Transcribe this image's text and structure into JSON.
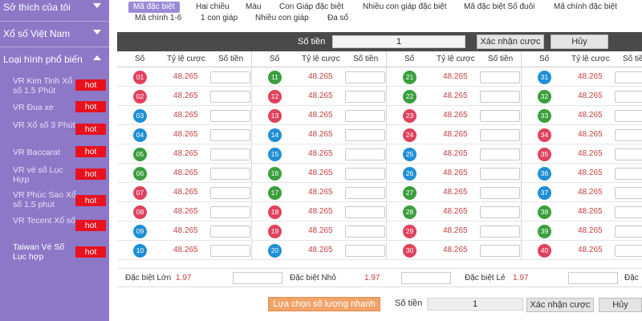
{
  "sidebar": {
    "sections": [
      {
        "label": "Sở thích của tôi",
        "open": false
      },
      {
        "label": "Xổ số Việt Nam",
        "open": false
      },
      {
        "label": "Loại hình phổ biến",
        "open": true
      }
    ],
    "items": [
      {
        "label": "VR Kim Tinh Xổ số 1.5 Phút",
        "badge": "hot"
      },
      {
        "label": "VR Đua xe",
        "badge": "hot"
      },
      {
        "label": "VR Xổ số 3 Phút",
        "badge": "hot"
      },
      {
        "label": "VR Baccarat",
        "badge": "hot"
      },
      {
        "label": "VR vé số Lục Hợp",
        "badge": "hot"
      },
      {
        "label": "VR Phúc Sao Xổ số 1.5 phút",
        "badge": "hot"
      },
      {
        "label": "VR Tecent Xổ số",
        "badge": "hot"
      },
      {
        "label": "Taiwan Vé Số Lục hợp",
        "badge": "hot"
      }
    ]
  },
  "tabs": [
    {
      "label": "Mã đặc biệt",
      "active": true
    },
    {
      "label": "Hai chiều"
    },
    {
      "label": "Màu"
    },
    {
      "label": "Con Giáp đặc biệt"
    },
    {
      "label": "Nhiều con giáp đặc biệt"
    },
    {
      "label": "Mã đặc biệt Số đuôi"
    },
    {
      "label": "Mã chính đặc biệt"
    },
    {
      "label": "Mã chính 1-6"
    },
    {
      "label": "1 con giáp"
    },
    {
      "label": "Nhiều con giáp"
    },
    {
      "label": "Đa số"
    }
  ],
  "topbar": {
    "amount_label": "Số tiền",
    "amount_value": "1",
    "confirm": "Xác nhận cược",
    "cancel": "Hủy"
  },
  "grid": {
    "headers": {
      "number": "Số",
      "odds": "Tỷ lệ cược",
      "amount": "Số tiền"
    },
    "odds": "48.265",
    "colors": {
      "red": "#e0425e",
      "green": "#3a9f3c",
      "blue": "#1f8fd6"
    },
    "numbers": [
      {
        "n": "01",
        "c": "red"
      },
      {
        "n": "02",
        "c": "red"
      },
      {
        "n": "03",
        "c": "blue"
      },
      {
        "n": "04",
        "c": "blue"
      },
      {
        "n": "05",
        "c": "green"
      },
      {
        "n": "06",
        "c": "green"
      },
      {
        "n": "07",
        "c": "red"
      },
      {
        "n": "08",
        "c": "red"
      },
      {
        "n": "09",
        "c": "blue"
      },
      {
        "n": "10",
        "c": "blue"
      },
      {
        "n": "11",
        "c": "green"
      },
      {
        "n": "12",
        "c": "red"
      },
      {
        "n": "13",
        "c": "red"
      },
      {
        "n": "14",
        "c": "blue"
      },
      {
        "n": "15",
        "c": "blue"
      },
      {
        "n": "16",
        "c": "green"
      },
      {
        "n": "17",
        "c": "green"
      },
      {
        "n": "18",
        "c": "red"
      },
      {
        "n": "19",
        "c": "red"
      },
      {
        "n": "20",
        "c": "blue"
      },
      {
        "n": "21",
        "c": "green"
      },
      {
        "n": "22",
        "c": "green"
      },
      {
        "n": "23",
        "c": "red"
      },
      {
        "n": "24",
        "c": "red"
      },
      {
        "n": "25",
        "c": "blue"
      },
      {
        "n": "26",
        "c": "blue"
      },
      {
        "n": "27",
        "c": "green"
      },
      {
        "n": "28",
        "c": "green"
      },
      {
        "n": "29",
        "c": "red"
      },
      {
        "n": "30",
        "c": "red"
      },
      {
        "n": "31",
        "c": "blue"
      },
      {
        "n": "32",
        "c": "green"
      },
      {
        "n": "33",
        "c": "green"
      },
      {
        "n": "34",
        "c": "red"
      },
      {
        "n": "35",
        "c": "red"
      },
      {
        "n": "36",
        "c": "blue"
      },
      {
        "n": "37",
        "c": "blue"
      },
      {
        "n": "38",
        "c": "green"
      },
      {
        "n": "39",
        "c": "green"
      },
      {
        "n": "40",
        "c": "red"
      }
    ]
  },
  "special": [
    {
      "label": "Đặc biệt Lớn",
      "odds": "1.97"
    },
    {
      "label": "Đặc biệt Nhỏ",
      "odds": "1.97"
    },
    {
      "label": "Đặc biệt Lẻ",
      "odds": "1.97"
    },
    {
      "label": "Đặc"
    }
  ],
  "bottom": {
    "quick": "Lựa chọn số lượng nhanh",
    "amount_label": "Số tiền",
    "amount_value": "1",
    "confirm": "Xác nhận cược",
    "cancel": "Hủy"
  }
}
